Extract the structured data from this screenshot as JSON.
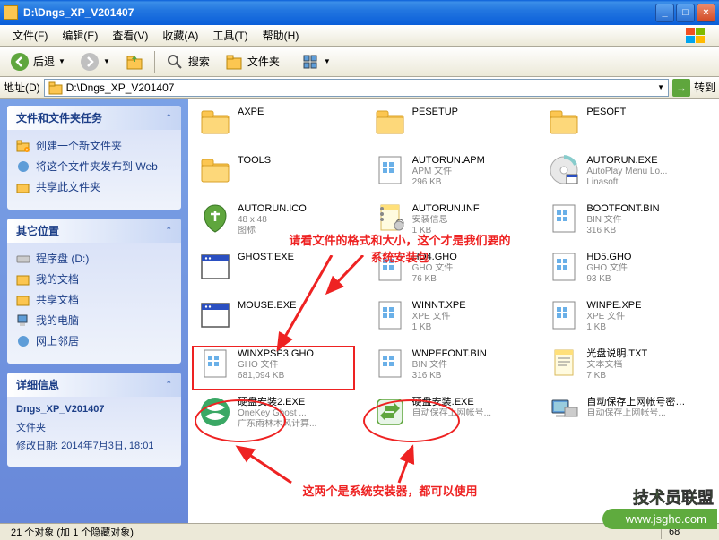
{
  "title": "D:\\Dngs_XP_V201407",
  "menus": [
    "文件(F)",
    "编辑(E)",
    "查看(V)",
    "收藏(A)",
    "工具(T)",
    "帮助(H)"
  ],
  "toolbar": {
    "back": "后退",
    "search": "搜索",
    "folders": "文件夹"
  },
  "addressbar": {
    "label": "地址(D)",
    "path": "D:\\Dngs_XP_V201407",
    "go": "转到"
  },
  "sidebar": {
    "tasks": {
      "title": "文件和文件夹任务",
      "items": [
        "创建一个新文件夹",
        "将这个文件夹发布到 Web",
        "共享此文件夹"
      ]
    },
    "places": {
      "title": "其它位置",
      "items": [
        "程序盘 (D:)",
        "我的文档",
        "共享文档",
        "我的电脑",
        "网上邻居"
      ]
    },
    "details": {
      "title": "详细信息",
      "name": "Dngs_XP_V201407",
      "type": "文件夹",
      "modified": "修改日期: 2014年7月3日, 18:01"
    }
  },
  "files": [
    {
      "name": "AXPE",
      "sub1": "",
      "sub2": "",
      "icon": "folder"
    },
    {
      "name": "PESETUP",
      "sub1": "",
      "sub2": "",
      "icon": "folder"
    },
    {
      "name": "PESOFT",
      "sub1": "",
      "sub2": "",
      "icon": "folder"
    },
    {
      "name": "TOOLS",
      "sub1": "",
      "sub2": "",
      "icon": "folder"
    },
    {
      "name": "AUTORUN.APM",
      "sub1": "APM 文件",
      "sub2": "296 KB",
      "icon": "file"
    },
    {
      "name": "AUTORUN.EXE",
      "sub1": "AutoPlay Menu Lo...",
      "sub2": "Linasoft",
      "icon": "cd"
    },
    {
      "name": "AUTORUN.ICO",
      "sub1": "48 x 48",
      "sub2": "图标",
      "icon": "ico"
    },
    {
      "name": "AUTORUN.INF",
      "sub1": "安装信息",
      "sub2": "1 KB",
      "icon": "inf"
    },
    {
      "name": "BOOTFONT.BIN",
      "sub1": "BIN 文件",
      "sub2": "316 KB",
      "icon": "file"
    },
    {
      "name": "GHOST.EXE",
      "sub1": "",
      "sub2": "",
      "icon": "exe"
    },
    {
      "name": "HD4.GHO",
      "sub1": "GHO 文件",
      "sub2": "76 KB",
      "icon": "file"
    },
    {
      "name": "HD5.GHO",
      "sub1": "GHO 文件",
      "sub2": "93 KB",
      "icon": "file"
    },
    {
      "name": "MOUSE.EXE",
      "sub1": "",
      "sub2": "",
      "icon": "exe"
    },
    {
      "name": "WINNT.XPE",
      "sub1": "XPE 文件",
      "sub2": "1 KB",
      "icon": "file"
    },
    {
      "name": "WINPE.XPE",
      "sub1": "XPE 文件",
      "sub2": "1 KB",
      "icon": "file"
    },
    {
      "name": "WINXPSP3.GHO",
      "sub1": "GHO 文件",
      "sub2": "681,094 KB",
      "icon": "file"
    },
    {
      "name": "WNPEFONT.BIN",
      "sub1": "BIN 文件",
      "sub2": "316 KB",
      "icon": "file"
    },
    {
      "name": "光盘说明.TXT",
      "sub1": "文本文档",
      "sub2": "7 KB",
      "icon": "txt"
    },
    {
      "name": "硬盘安装2.EXE",
      "sub1": "OneKey Ghost ...",
      "sub2": "广东雨林木风计算...",
      "icon": "green"
    },
    {
      "name": "硬盘安装.EXE",
      "sub1": "自动保存上网帐号...",
      "sub2": "",
      "icon": "green2"
    },
    {
      "name": "自动保存上网帐号密码到U盘.EXE",
      "sub1": "自动保存上网帐号...",
      "sub2": "",
      "icon": "pc"
    }
  ],
  "annotations": {
    "top": "请看文件的格式和大小，这个才是我们要的\n系统安装包",
    "bottom": "这两个是系统安装器，都可以使用"
  },
  "status": {
    "left": "21 个对象 (加 1 个隐藏对象)",
    "size": "68"
  },
  "watermark": {
    "title": "技术员联盟",
    "url": "www.jsgho.com"
  }
}
